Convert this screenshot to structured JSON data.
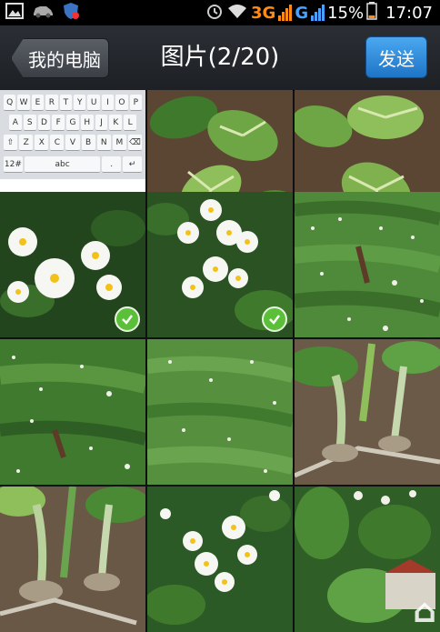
{
  "status_bar": {
    "icons_left": [
      "gallery-icon",
      "car-icon",
      "shield-icon"
    ],
    "net_3g": "3G",
    "net_g": "G",
    "battery_percent": "15%",
    "time": "17:07"
  },
  "header": {
    "back_label": "我的电脑",
    "title": "图片(2/20)",
    "send_label": "发送"
  },
  "keyboard": {
    "rows": [
      [
        "Q",
        "W",
        "E",
        "R",
        "T",
        "Y",
        "U",
        "I",
        "O",
        "P"
      ],
      [
        "A",
        "S",
        "D",
        "F",
        "G",
        "H",
        "J",
        "K",
        "L"
      ],
      [
        "⇧",
        "Z",
        "X",
        "C",
        "V",
        "B",
        "N",
        "M",
        "⌫"
      ],
      [
        "12#",
        "",
        "abc",
        "",
        "",
        "",
        ".",
        "↵"
      ]
    ]
  },
  "photos": [
    {
      "kind": "keyboard-screenshot",
      "selected": false
    },
    {
      "kind": "leaves",
      "selected": false
    },
    {
      "kind": "leaves",
      "selected": false
    },
    {
      "kind": "flowers-close",
      "selected": true
    },
    {
      "kind": "flowers-close",
      "selected": true
    },
    {
      "kind": "field",
      "selected": false
    },
    {
      "kind": "field",
      "selected": false
    },
    {
      "kind": "field",
      "selected": false
    },
    {
      "kind": "stems",
      "selected": false
    },
    {
      "kind": "stems",
      "selected": false
    },
    {
      "kind": "flowers-close",
      "selected": false
    },
    {
      "kind": "plants",
      "selected": false
    }
  ],
  "colors": {
    "accent_blue": "#1f74c6",
    "check_green": "#5cbf3a",
    "net_orange": "#ff8a17",
    "net_blue": "#4aa0ff"
  }
}
